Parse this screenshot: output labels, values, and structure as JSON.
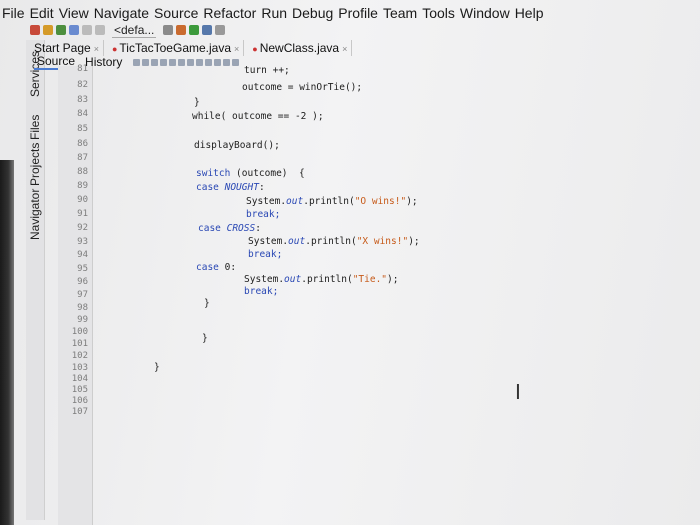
{
  "menubar": [
    "File",
    "Edit",
    "View",
    "Navigate",
    "Source",
    "Refactor",
    "Run",
    "Debug",
    "Profile",
    "Team",
    "Tools",
    "Window",
    "Help"
  ],
  "toolbar": {
    "config_combo": "<defa..."
  },
  "tabs": [
    {
      "label": "Start Page",
      "modified": false
    },
    {
      "label": "TicTacToeGame.java",
      "modified": true
    },
    {
      "label": "NewClass.java",
      "modified": true
    }
  ],
  "subtabs": [
    {
      "label": "Source",
      "active": true
    },
    {
      "label": "History",
      "active": false
    }
  ],
  "sidebar_labels": [
    "Services",
    "Files",
    "Projects",
    "Navigator"
  ],
  "line_numbers": [
    "81",
    "82",
    "83",
    "84",
    "85",
    "86",
    "87",
    "88",
    "89",
    "90",
    "91",
    "92",
    "93",
    "94",
    "95",
    "96",
    "97",
    "98",
    "99",
    "100",
    "101",
    "102",
    "103",
    "104",
    "105",
    "106",
    "107"
  ],
  "code": {
    "l81": "turn ++;",
    "l82": "outcome = winOrTie();",
    "l83": "}",
    "l84": "while( outcome == -2 );",
    "l86": "displayBoard();",
    "l88a": "switch",
    "l88b": " (outcome)  {",
    "l89a": "case ",
    "l89b": "NOUGHT",
    "l89c": ":",
    "l90a": "System.",
    "l90b": "out",
    "l90c": ".println(",
    "l90d": "\"O wins!\"",
    "l90e": ");",
    "l91": "break;",
    "l92a": "case ",
    "l92b": "CROSS",
    "l92c": ":",
    "l93a": "System.",
    "l93b": "out",
    "l93c": ".println(",
    "l93d": "\"X wins!\"",
    "l93e": ");",
    "l94": "break;",
    "l95a": "case ",
    "l95b": "0:",
    "l96a": "System.",
    "l96b": "out",
    "l96c": ".println(",
    "l96d": "\"Tie.\"",
    "l96e": ");",
    "l97": "break;",
    "l98": "}",
    "l100": "}",
    "l102": "}"
  },
  "colors": {
    "keyword": "#2a48b4",
    "string": "#c75b1a",
    "line_number": "#7d7d7d"
  }
}
